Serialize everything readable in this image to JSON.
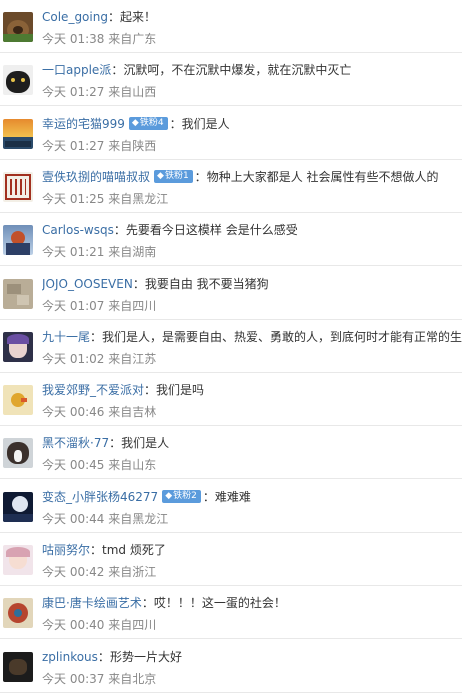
{
  "comments": [
    {
      "user": "Cole_going",
      "badge": "",
      "text": "起来！",
      "meta": "今天 01:38 来自广东",
      "avatar": "bear"
    },
    {
      "user": "一口apple派",
      "badge": "",
      "text": "沉默呵，不在沉默中爆发，就在沉默中灭亡",
      "meta": "今天 01:27 来自山西",
      "avatar": "cat"
    },
    {
      "user": "幸运的宅猫999",
      "badge": "铁粉4",
      "text": "我们是人",
      "meta": "今天 01:27 来自陕西",
      "avatar": "sunset"
    },
    {
      "user": "壹佚玖捌的喵喵叔叔",
      "badge": "铁粉1",
      "text": "物种上大家都是人 社会属性有些不想做人的",
      "meta": "今天 01:25 来自黑龙江",
      "avatar": "seal"
    },
    {
      "user": "Carlos-wsqs",
      "badge": "",
      "text": "先要看今日这模样 会是什么感受",
      "meta": "今天 01:21 来自湖南",
      "avatar": "figure"
    },
    {
      "user": "JOJO_OOSEVEN",
      "badge": "",
      "text": "我要自由 我不要当猪狗",
      "meta": "今天 01:07 来自四川",
      "avatar": "stone"
    },
    {
      "user": "九十一尾",
      "badge": "",
      "text": "我们是人，是需要自由、热爱、勇敢的人，到底何时才能有正常的生",
      "meta": "今天 01:02 来自江苏",
      "avatar": "anime"
    },
    {
      "user": "我爱郊野_不爱派对",
      "badge": "",
      "text": "我们是吗",
      "meta": "今天 00:46 来自吉林",
      "avatar": "duck"
    },
    {
      "user": "黑不溜秋·77",
      "badge": "",
      "text": "我们是人",
      "meta": "今天 00:45 来自山东",
      "avatar": "dog"
    },
    {
      "user": "变态_小胖张杨46277",
      "badge": "铁粉2",
      "text": "难难难",
      "meta": "今天 00:44 来自黑龙江",
      "avatar": "moon"
    },
    {
      "user": "咕丽努尔",
      "badge": "",
      "text": "tmd 烦死了",
      "meta": "今天 00:42 来自浙江",
      "avatar": "girl"
    },
    {
      "user": "康巴·唐卡绘画艺术",
      "badge": "",
      "text": "哎！！！这一蛋的社会！",
      "meta": "今天 00:40 来自四川",
      "avatar": "painting"
    },
    {
      "user": "zplinkous",
      "badge": "",
      "text": "形势一片大好",
      "meta": "今天 00:37 来自北京",
      "avatar": "dark"
    }
  ],
  "colors": {
    "name": "#3a6ea5",
    "text": "#333333",
    "meta": "#888888",
    "badge": "#5b9bdc",
    "divider": "#e8e8e8"
  },
  "icons": {
    "badge": "diamond-icon"
  }
}
